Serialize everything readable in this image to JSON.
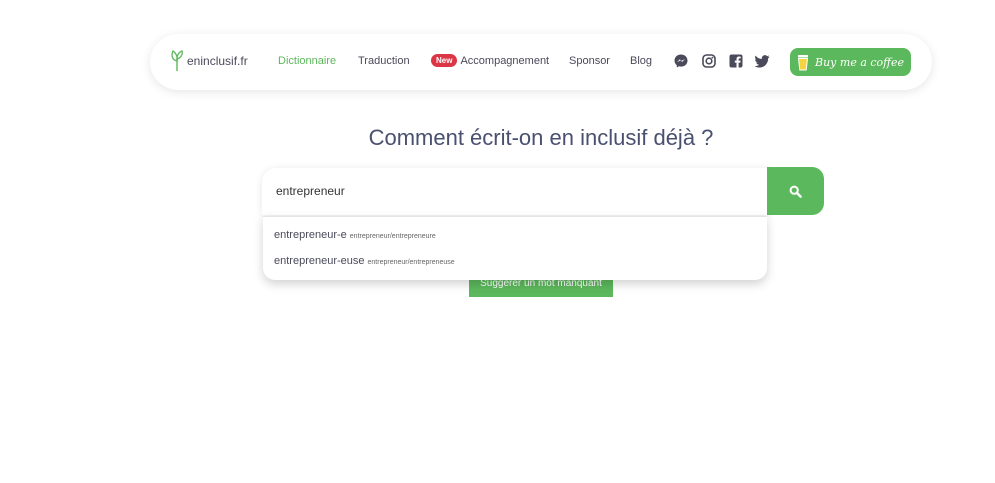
{
  "navbar": {
    "logo_text": "eninclusif.fr",
    "links": [
      "Dictionnaire",
      "Traduction",
      "Accompagnement",
      "Sponsor",
      "Blog"
    ],
    "new_badge": "New",
    "coffee_label": "Buy me a coffee"
  },
  "social_icons": [
    "messenger-icon",
    "instagram-icon",
    "facebook-icon",
    "twitter-icon"
  ],
  "heading": "Comment écrit-on en inclusif déjà ?",
  "search": {
    "value": "entrepreneur"
  },
  "suggestions": [
    {
      "word": "entrepreneur-e",
      "forms": "entrepreneur/entrepreneure"
    },
    {
      "word": "entrepreneur-euse",
      "forms": "entrepreneur/entrepreneuse"
    }
  ],
  "suggest_button": "Suggérer un mot manquant",
  "colors": {
    "accent": "#5cb85c",
    "badge": "#dc3545",
    "heading": "#495070"
  }
}
